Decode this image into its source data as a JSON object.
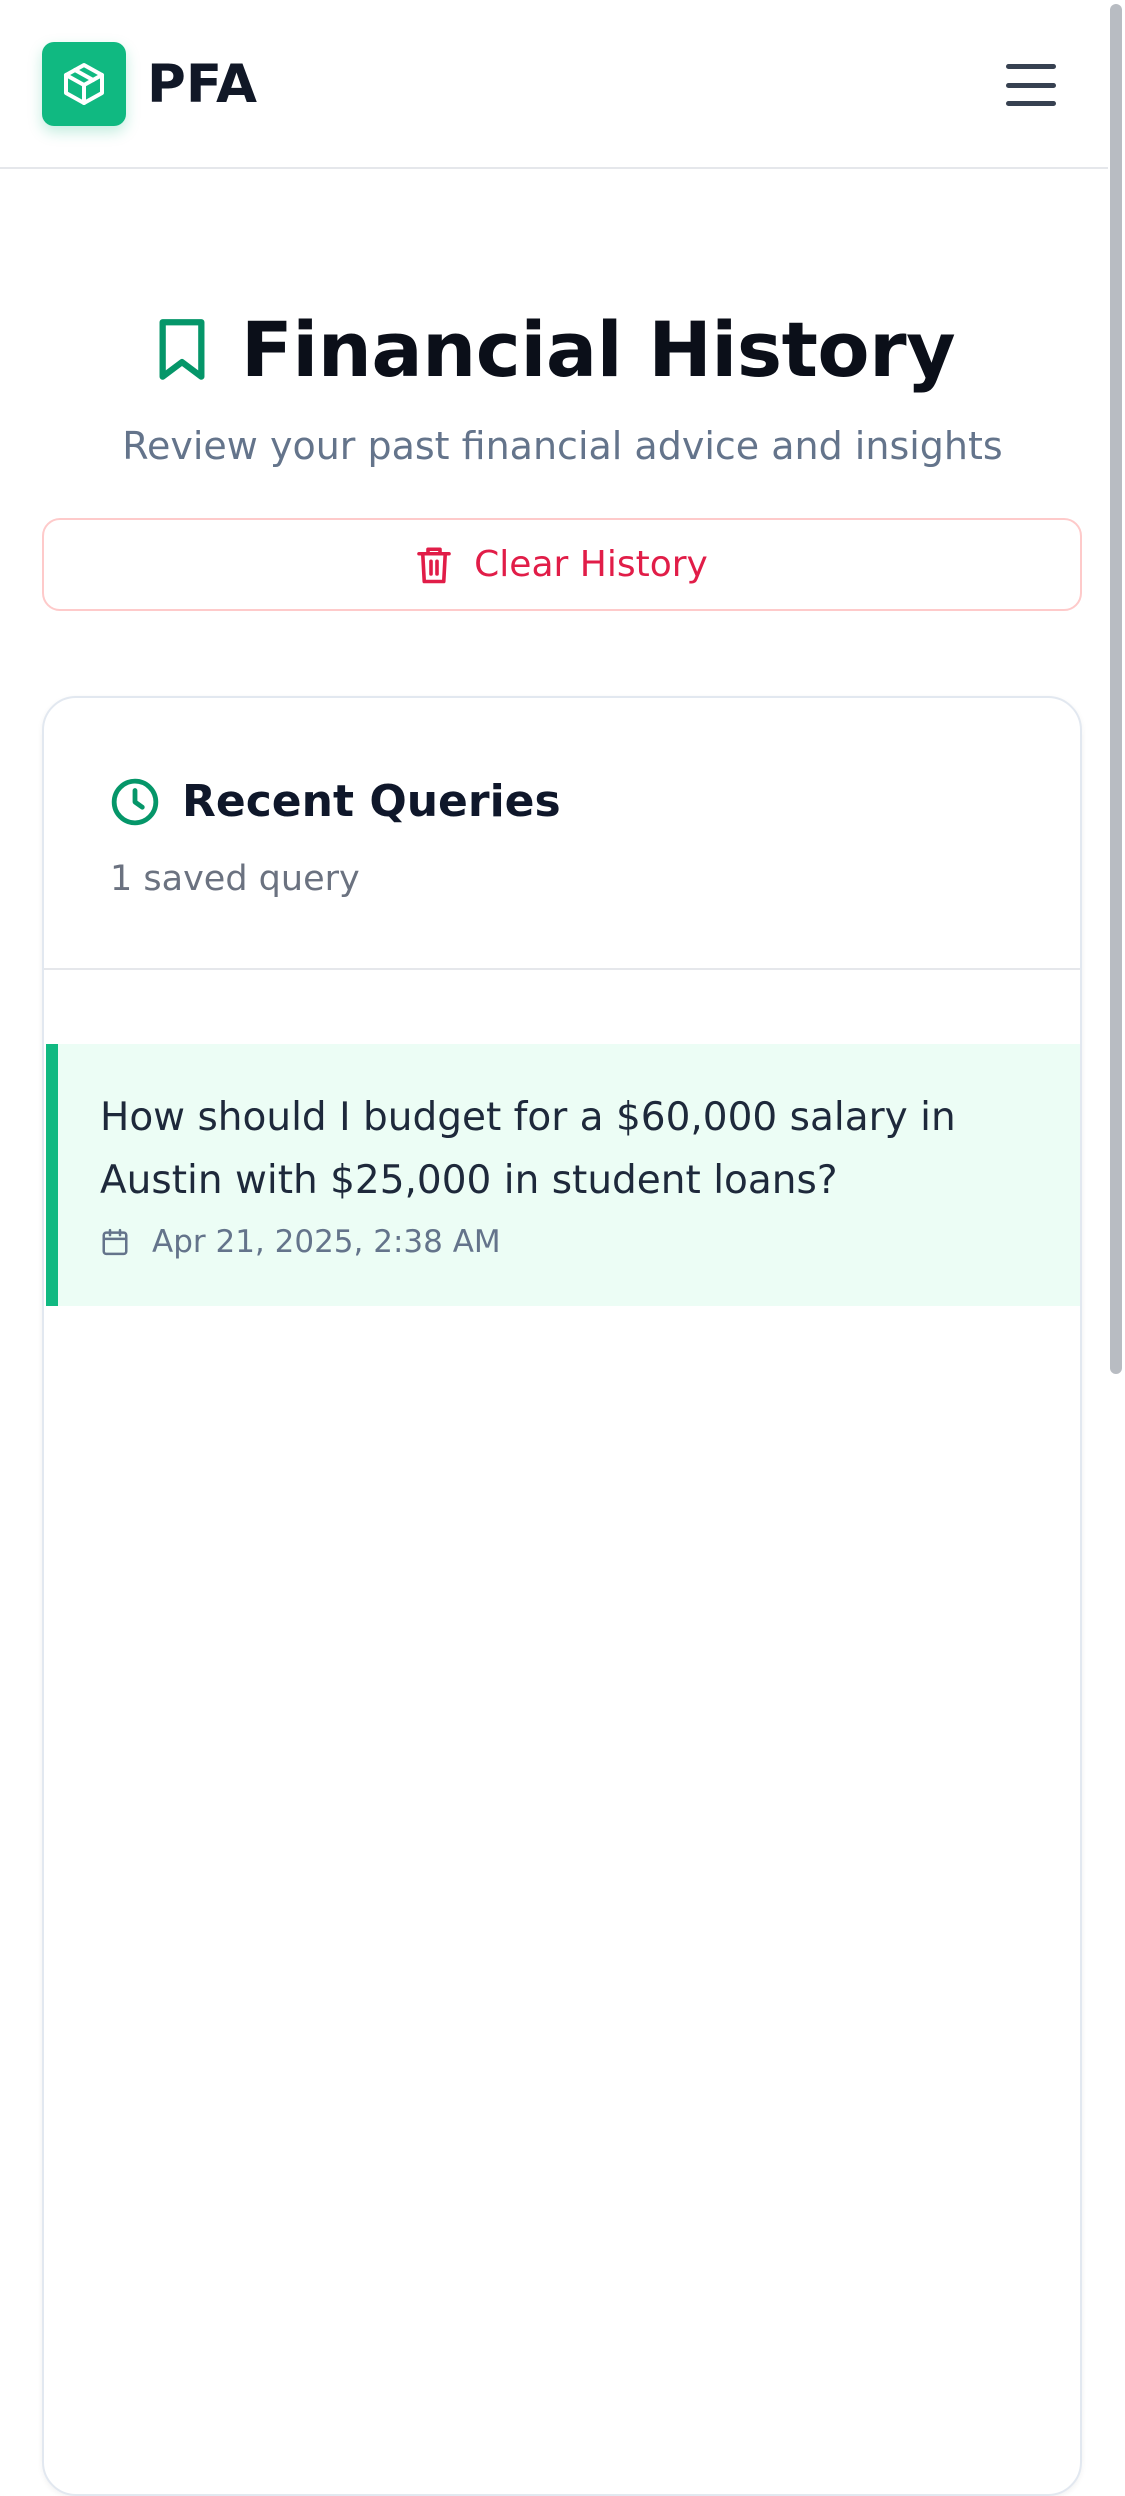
{
  "header": {
    "app_name": "PFA",
    "logo_icon": "cube-icon",
    "menu_icon": "hamburger-menu-icon"
  },
  "page": {
    "title": "Financial History",
    "title_icon": "bookmark-icon",
    "subtitle": "Review your past financial advice and insights"
  },
  "actions": {
    "clear_label": "Clear History",
    "clear_icon": "trash-icon"
  },
  "card": {
    "title": "Recent Queries",
    "title_icon": "clock-icon",
    "count_text": "1 saved query"
  },
  "queries": [
    {
      "text": "How should I budget for a $60,000 salary in Austin with $25,000 in student loans?",
      "date": "Apr 21, 2025, 2:38 AM",
      "date_icon": "calendar-icon"
    }
  ],
  "colors": {
    "brand": "#10b981",
    "brand_dark": "#059669",
    "danger": "#e11d48",
    "danger_border": "#fecaca",
    "selected_bg": "#ecfdf5"
  }
}
